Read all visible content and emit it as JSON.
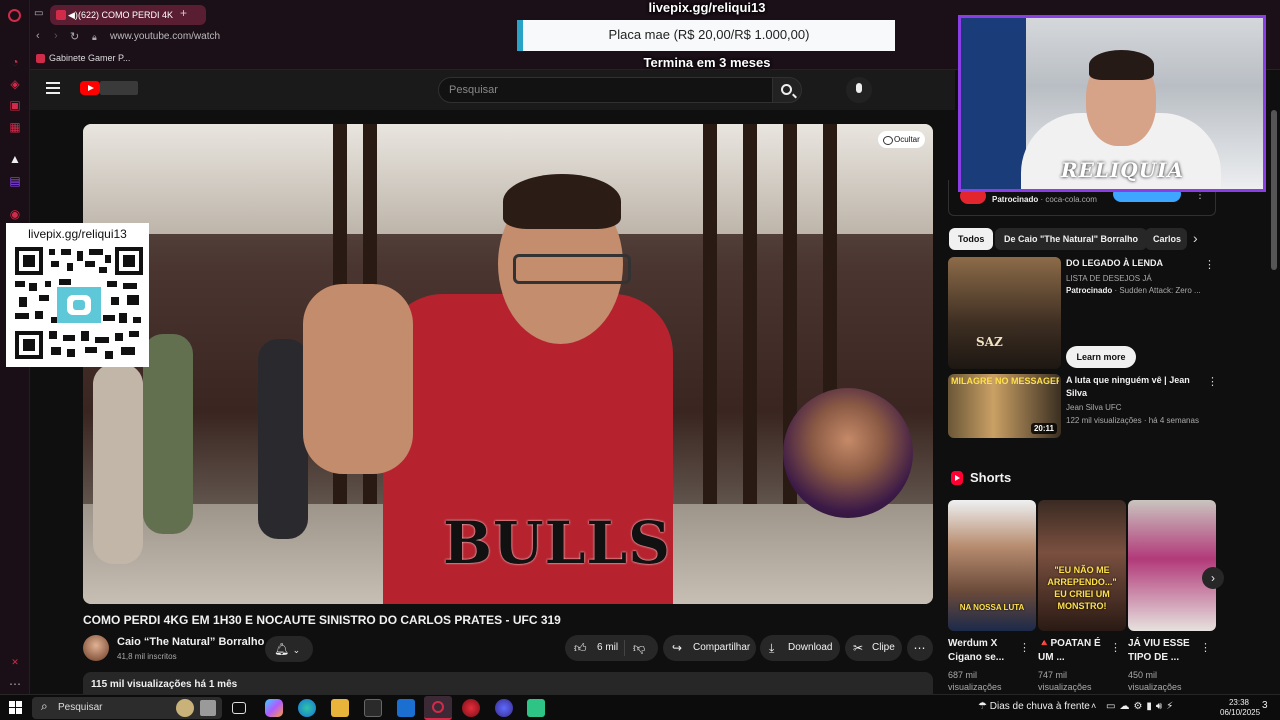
{
  "browser": {
    "tab_label": "(622) COMO PERDI 4K",
    "url": "www.youtube.com/watch",
    "bookmark": "Gabinete Gamer P..."
  },
  "header": {
    "search_placeholder": "Pesquisar"
  },
  "overlay": {
    "goal_site": "livepix.gg/reliqui13",
    "goal_text": "Placa mae (R$ 20,00/R$ 1.000,00)",
    "goal_fraction": 0.02,
    "goal_deadline": "Termina em 3 meses",
    "qr_label": "livepix.gg/reliqui13",
    "webcam_label": "RELIQUIA"
  },
  "player": {
    "hide_label": "Ocultar",
    "shirt_text": "BULLS"
  },
  "video": {
    "title": "COMO PERDI 4KG EM 1H30 E NOCAUTE SINISTRO DO CARLOS PRATES - UFC 319",
    "channel": "Caio “The Natural” Borralho",
    "subscribers": "41,8 mil inscritos",
    "likes": "6 mil",
    "share": "Compartilhar",
    "download": "Download",
    "clip": "Clipe",
    "views_date": "115 mil visualizações  há 1 mês"
  },
  "sidebar": {
    "sponsored_label": "Patrocinado",
    "sponsored_domain": "coca-cola.com",
    "chips": [
      "Todos",
      "De Caio \"The Natural\" Borralho",
      "Carlos"
    ],
    "recs": [
      {
        "title": "DO LEGADO À LENDA",
        "line1": "LISTA DE DESEJOS JÁ",
        "sponsor": "Patrocinado",
        "sponsor_detail": "Sudden Attack: Zero ...",
        "cta": "Learn more",
        "thumb_text": "SAZ"
      },
      {
        "title": "A luta que ninguém vê | Jean Silva",
        "channel": "Jean Silva UFC",
        "meta": "122 mil visualizações · há 4 semanas",
        "duration": "20:11",
        "thumb_text": "MILAGRE NO MESSAGER"
      }
    ],
    "shorts_label": "Shorts",
    "shorts": [
      {
        "title": "Werdum X Cigano se...",
        "views": "687 mil visualizações",
        "thumb_text": "NA NOSSA LUTA"
      },
      {
        "title": "🔺POATAN É UM ...",
        "views": "747 mil visualizações",
        "thumb_text": "\"EU NÃO ME ARREPENDO...\" EU CRIEI UM MONSTRO!"
      },
      {
        "title": "JÁ VIU ESSE TIPO DE ...",
        "views": "450 mil visualizações",
        "thumb_text": ""
      }
    ]
  },
  "taskbar": {
    "search_placeholder": "Pesquisar",
    "weather": "Dias de chuva à frente",
    "time": "23:38",
    "date": "06/10/2025",
    "notification_count": "3"
  }
}
